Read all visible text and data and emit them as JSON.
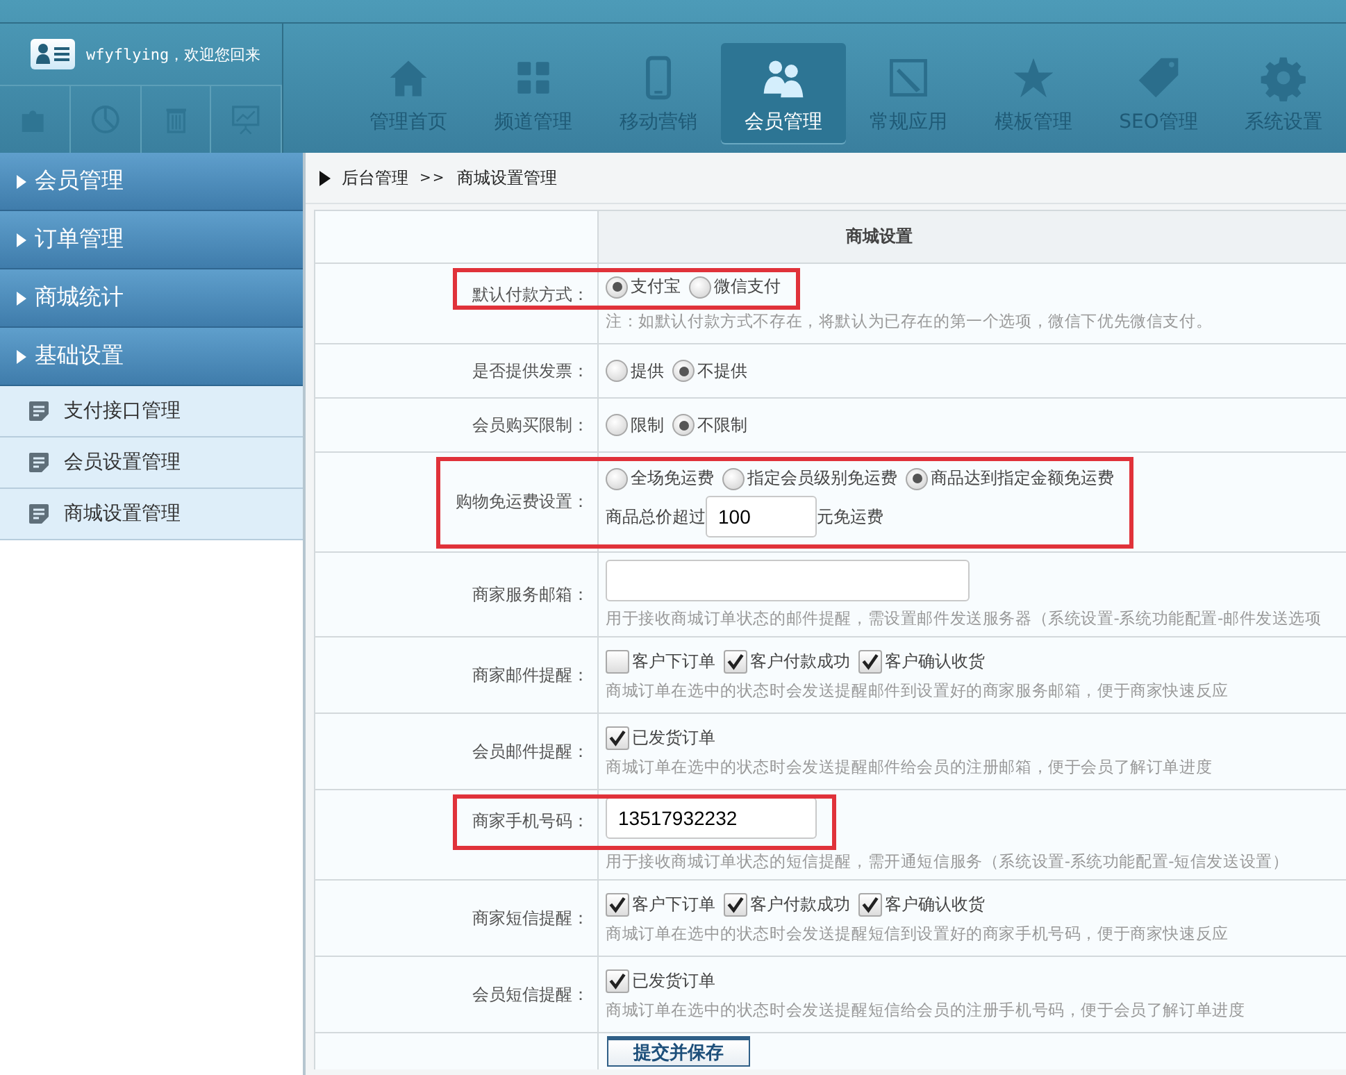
{
  "user": {
    "greeting": "wfyflying，欢迎您回来"
  },
  "tabs": [
    {
      "label": "管理首页",
      "selected": false
    },
    {
      "label": "频道管理",
      "selected": false
    },
    {
      "label": "移动营销",
      "selected": false
    },
    {
      "label": "会员管理",
      "selected": true
    },
    {
      "label": "常规应用",
      "selected": false
    },
    {
      "label": "模板管理",
      "selected": false
    },
    {
      "label": "SEO管理",
      "selected": false
    },
    {
      "label": "系统设置",
      "selected": false
    }
  ],
  "sidebar": {
    "items": [
      {
        "label": "会员管理"
      },
      {
        "label": "订单管理"
      },
      {
        "label": "商城统计"
      },
      {
        "label": "基础设置",
        "children": [
          {
            "label": "支付接口管理"
          },
          {
            "label": "会员设置管理"
          },
          {
            "label": "商城设置管理"
          }
        ]
      }
    ]
  },
  "breadcrumb": {
    "root": "后台管理",
    "separator": ">>",
    "current": "商城设置管理"
  },
  "form": {
    "title": "商城设置",
    "rows": [
      {
        "kind": "radio",
        "label": "默认付款方式：",
        "highlighted": true,
        "options": [
          {
            "label": "支付宝",
            "selected": true
          },
          {
            "label": "微信支付",
            "selected": false
          }
        ],
        "hint": "注：如默认付款方式不存在，将默认为已存在的第一个选项，微信下优先微信支付。"
      },
      {
        "kind": "radio",
        "label": "是否提供发票：",
        "highlighted": false,
        "options": [
          {
            "label": "提供",
            "selected": false
          },
          {
            "label": "不提供",
            "selected": true
          }
        ]
      },
      {
        "kind": "radio",
        "label": "会员购买限制：",
        "highlighted": false,
        "options": [
          {
            "label": "限制",
            "selected": false
          },
          {
            "label": "不限制",
            "selected": true
          }
        ]
      },
      {
        "kind": "radio",
        "label": "购物免运费设置：",
        "highlighted": true,
        "options": [
          {
            "label": "全场免运费",
            "selected": false
          },
          {
            "label": "指定会员级别免运费",
            "selected": false
          },
          {
            "label": "商品达到指定金额免运费",
            "selected": true
          }
        ],
        "amount": {
          "prefix": "商品总价超过",
          "value": "100",
          "suffix": "元免运费"
        }
      },
      {
        "kind": "text",
        "label": "商家服务邮箱：",
        "highlighted": false,
        "value": "",
        "hint": "用于接收商城订单状态的邮件提醒，需设置邮件发送服务器（系统设置-系统功能配置-邮件发送选项"
      },
      {
        "kind": "checks",
        "label": "商家邮件提醒：",
        "highlighted": false,
        "options": [
          {
            "label": "客户下订单",
            "checked": false
          },
          {
            "label": "客户付款成功",
            "checked": true
          },
          {
            "label": "客户确认收货",
            "checked": true
          }
        ],
        "hint": "商城订单在选中的状态时会发送提醒邮件到设置好的商家服务邮箱，便于商家快速反应"
      },
      {
        "kind": "checks",
        "label": "会员邮件提醒：",
        "highlighted": false,
        "options": [
          {
            "label": "已发货订单",
            "checked": true
          }
        ],
        "hint": "商城订单在选中的状态时会发送提醒邮件给会员的注册邮箱，便于会员了解订单进度"
      },
      {
        "kind": "text",
        "label": "商家手机号码：",
        "highlighted": true,
        "value": "13517932232",
        "hint": "用于接收商城订单状态的短信提醒，需开通短信服务（系统设置-系统功能配置-短信发送设置）"
      },
      {
        "kind": "checks",
        "label": "商家短信提醒：",
        "highlighted": false,
        "options": [
          {
            "label": "客户下订单",
            "checked": true
          },
          {
            "label": "客户付款成功",
            "checked": true
          },
          {
            "label": "客户确认收货",
            "checked": true
          }
        ],
        "hint": "商城订单在选中的状态时会发送提醒短信到设置好的商家手机号码，便于商家快速反应"
      },
      {
        "kind": "checks",
        "label": "会员短信提醒：",
        "highlighted": false,
        "options": [
          {
            "label": "已发货订单",
            "checked": true
          }
        ],
        "hint": "商城订单在选中的状态时会发送提醒短信给会员的注册手机号码，便于会员了解订单进度"
      }
    ],
    "submit": "提交并保存"
  }
}
